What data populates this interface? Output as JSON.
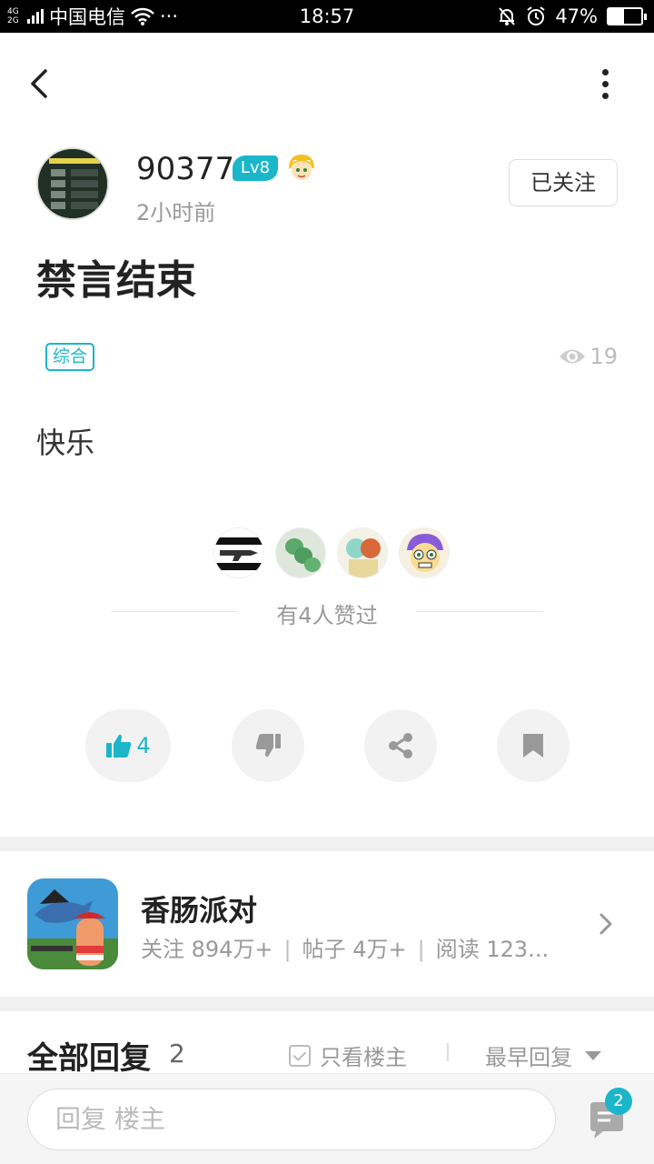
{
  "status_bar": {
    "network": "4G 2G",
    "carrier": "中国电信",
    "more": "···",
    "time": "18:57",
    "battery": "47%",
    "battery_level": 0.47
  },
  "post": {
    "author": "90377",
    "level": "Lv8",
    "time_ago": "2小时前",
    "follow_label": "已关注",
    "title": "禁言结束",
    "tag": "综合",
    "views": "19",
    "body": "快乐",
    "likers_text": "有4人赞过",
    "like_count": "4"
  },
  "game": {
    "name": "香肠派对",
    "followers": "关注 894万+",
    "posts": "帖子 4万+",
    "reads": "阅读 123..."
  },
  "replies": {
    "title": "全部回复",
    "count": "2",
    "only_op": "只看楼主",
    "sort": "最早回复"
  },
  "bottom": {
    "placeholder": "回复  楼主",
    "badge": "2"
  },
  "colors": {
    "accent": "#1bb6c9"
  }
}
